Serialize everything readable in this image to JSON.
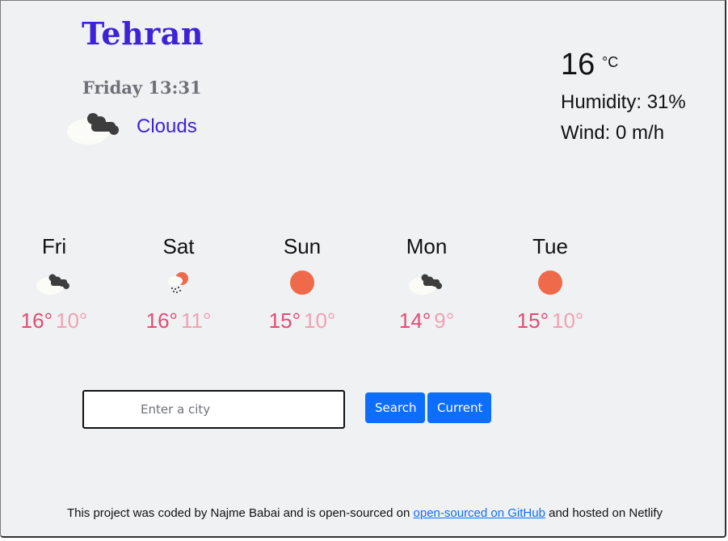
{
  "location": {
    "city": "Tehran",
    "datetime": "Friday 13:31",
    "description": "Clouds",
    "icon": "broken-clouds-icon"
  },
  "current": {
    "temperature": "16",
    "unit": "°C",
    "humidity": "Humidity: 31%",
    "wind": "Wind: 0 m/h"
  },
  "forecast": [
    {
      "day": "Fri",
      "icon": "broken-clouds-icon",
      "high": "16°",
      "low": "10°"
    },
    {
      "day": "Sat",
      "icon": "rain-sun-icon",
      "high": "16°",
      "low": "11°"
    },
    {
      "day": "Sun",
      "icon": "sun-icon",
      "high": "15°",
      "low": "10°"
    },
    {
      "day": "Mon",
      "icon": "broken-clouds-icon",
      "high": "14°",
      "low": "9°"
    },
    {
      "day": "Tue",
      "icon": "sun-icon",
      "high": "15°",
      "low": "10°"
    }
  ],
  "search": {
    "placeholder": "Enter a city",
    "value": "",
    "search_label": "Search",
    "current_label": "Current"
  },
  "footer": {
    "text_before": "This project was coded by Najme Babai and is open-sourced on",
    "link_text": "open-sourced on GitHub",
    "text_after": "and hosted on Netlify"
  },
  "colors": {
    "accent": "#3f22d6",
    "high_temp": "#e04e76",
    "low_temp": "#f0a2b4",
    "button": "#0d6efd",
    "sun": "#ef6a4a"
  }
}
